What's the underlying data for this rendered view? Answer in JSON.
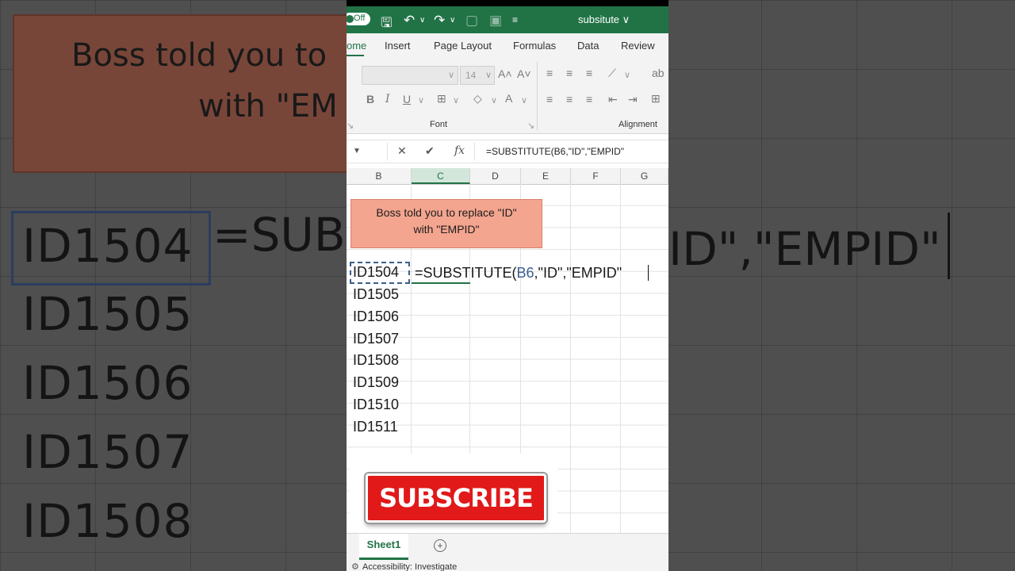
{
  "window": {
    "title": "subsitute",
    "autosave_label": "Off"
  },
  "ribbon_tabs": [
    "ome",
    "Insert",
    "Page Layout",
    "Formulas",
    "Data",
    "Review"
  ],
  "ribbon": {
    "font_size": "14",
    "group_font": "Font",
    "group_alignment": "Alignment"
  },
  "formula_bar": {
    "formula": "=SUBSTITUTE(B6,\"ID\",\"EMPID\""
  },
  "columns": [
    "B",
    "C",
    "D",
    "E",
    "F",
    "G"
  ],
  "note": {
    "line1": "Boss told you to replace \"ID\"",
    "line2": "with \"EMPID\""
  },
  "cells": {
    "b_values": [
      "ID1504",
      "ID1505",
      "ID1506",
      "ID1507",
      "ID1508",
      "ID1509",
      "ID1510",
      "ID1511"
    ],
    "edit_prefix": "=SUBSTITUTE(",
    "edit_ref": "B6",
    "edit_suffix": ",\"ID\",\"EMPID\""
  },
  "overlay": {
    "subscribe_label": "SUBSCRIBE"
  },
  "sheets": [
    "Sheet1"
  ],
  "status": {
    "accessibility": "Accessibility: Investigate"
  },
  "background": {
    "note_line1": "Boss told you to",
    "note_line2": "with \"EM",
    "big_values": [
      "ID1504",
      "ID1505",
      "ID1506",
      "ID1507",
      "ID1508"
    ],
    "formula_left": "=SUBS",
    "formula_right": "ID\",\"EMPID\""
  },
  "colors": {
    "excel_green": "#217346",
    "note_fill": "#f4a58f",
    "subscribe_red": "#e11919"
  }
}
